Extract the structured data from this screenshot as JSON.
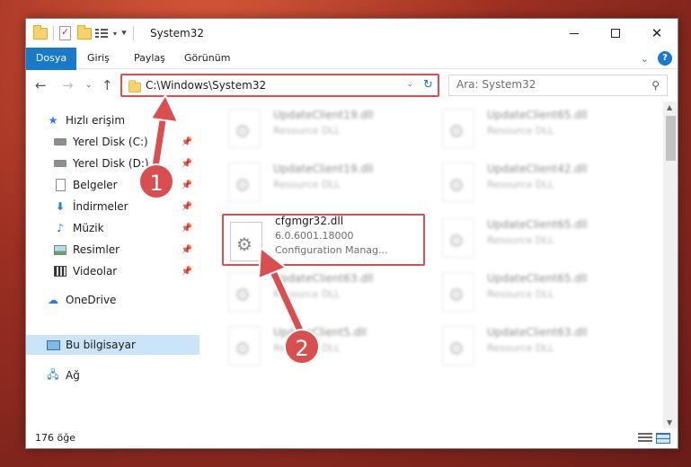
{
  "window": {
    "title": "System32",
    "icons": [
      "folder-icon",
      "properties-icon",
      "new-folder-icon",
      "view-options-icon"
    ]
  },
  "ribbon": {
    "tabs": [
      {
        "label": "Dosya"
      },
      {
        "label": "Giriş"
      },
      {
        "label": "Paylaş"
      },
      {
        "label": "Görünüm"
      }
    ]
  },
  "address": {
    "path": "C:\\Windows\\System32",
    "search_placeholder": "Ara: System32"
  },
  "sidebar": {
    "items": [
      {
        "label": "Hızlı erişim",
        "icon": "star-icon"
      },
      {
        "label": "Yerel Disk (C:)",
        "icon": "disk-icon",
        "pinned": true
      },
      {
        "label": "Yerel Disk (D:)",
        "icon": "disk-icon",
        "pinned": true
      },
      {
        "label": "Belgeler",
        "icon": "document-icon",
        "pinned": true
      },
      {
        "label": "İndirmeler",
        "icon": "download-icon",
        "pinned": true
      },
      {
        "label": "Müzik",
        "icon": "music-icon",
        "pinned": true
      },
      {
        "label": "Resimler",
        "icon": "pictures-icon",
        "pinned": true
      },
      {
        "label": "Videolar",
        "icon": "videos-icon",
        "pinned": true
      },
      {
        "label": "OneDrive",
        "icon": "cloud-icon"
      },
      {
        "label": "Bu bilgisayar",
        "icon": "computer-icon",
        "selected": true
      },
      {
        "label": "Ağ",
        "icon": "network-icon"
      }
    ]
  },
  "files": {
    "left": [
      {
        "name": "UpdateClient19.dll",
        "desc": "Resource DLL"
      },
      {
        "name": "UpdateClient19.dll",
        "desc": "Resource DLL"
      },
      {
        "name": "cfgmgr32.dll",
        "desc": "6.0.6001.18000",
        "desc2": "Configuration Manag..."
      },
      {
        "name": "UpdateClient63.dll",
        "desc": "Resource DLL"
      },
      {
        "name": "UpdateClient5.dll",
        "desc": "Resource DLL"
      }
    ],
    "right": [
      {
        "name": "UpdateClient65.dll",
        "desc": "Resource DLL"
      },
      {
        "name": "UpdateClient42.dll",
        "desc": "Resource DLL"
      },
      {
        "name": "UpdateClient65.dll",
        "desc": "Resource DLL"
      },
      {
        "name": "UpdateClient65.dll",
        "desc": "Resource DLL"
      },
      {
        "name": "UpdateClient63.dll",
        "desc": "Resource DLL"
      }
    ]
  },
  "status": {
    "count": "176 öğe"
  },
  "annotations": {
    "step1": "1",
    "step2": "2",
    "color": "#d94f50"
  }
}
